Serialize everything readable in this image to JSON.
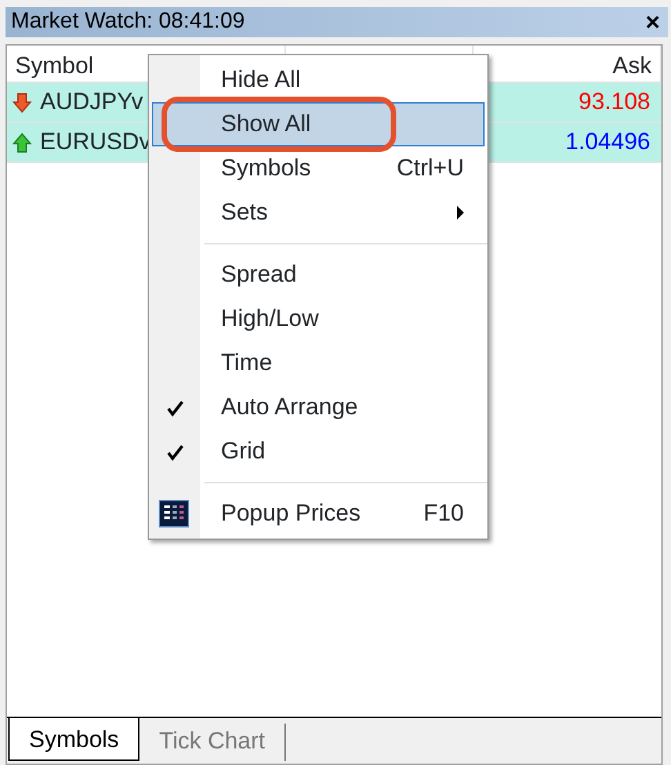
{
  "window": {
    "title": "Market Watch: 08:41:09",
    "close": "×"
  },
  "table": {
    "columns": [
      "Symbol",
      "Ask"
    ],
    "rows": [
      {
        "rising": false,
        "symbol": "AUDJPYv",
        "ask": "93.108"
      },
      {
        "rising": true,
        "symbol": "EURUSDv",
        "ask": "1.04496"
      }
    ]
  },
  "context_menu": {
    "items": [
      {
        "kind": "item",
        "label": "Hide All",
        "selected": false,
        "circled": false
      },
      {
        "kind": "item",
        "label": "Show All",
        "selected": true,
        "circled": true
      },
      {
        "kind": "item",
        "label": "Symbols",
        "shortcut": "Ctrl+U",
        "selected": false,
        "circled": false
      },
      {
        "kind": "submenu",
        "label": "Sets",
        "selected": false,
        "circled": false
      },
      {
        "kind": "separator"
      },
      {
        "kind": "item",
        "label": "Spread",
        "selected": false,
        "circled": false
      },
      {
        "kind": "item",
        "label": "High/Low",
        "selected": false,
        "circled": false
      },
      {
        "kind": "item",
        "label": "Time",
        "selected": false,
        "circled": false
      },
      {
        "kind": "check",
        "label": "Auto Arrange",
        "checked": true,
        "selected": false,
        "circled": false
      },
      {
        "kind": "check",
        "label": "Grid",
        "checked": true,
        "selected": false,
        "circled": false
      },
      {
        "kind": "separator"
      },
      {
        "kind": "icon",
        "label": "Popup Prices",
        "shortcut": "F10",
        "selected": false,
        "circled": false
      }
    ]
  },
  "tabs": [
    {
      "label": "Symbols",
      "selected": true
    },
    {
      "label": "Tick Chart",
      "selected": false
    }
  ]
}
